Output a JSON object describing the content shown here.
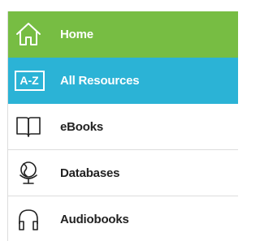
{
  "menu": {
    "items": [
      {
        "label": "Home",
        "icon": "home-icon",
        "state": "home"
      },
      {
        "label": "All Resources",
        "icon": "az-icon",
        "icon_text": "A-Z",
        "state": "active"
      },
      {
        "label": "eBooks",
        "icon": "book-icon",
        "state": "plain"
      },
      {
        "label": "Databases",
        "icon": "globe-icon",
        "state": "plain"
      },
      {
        "label": "Audiobooks",
        "icon": "headphones-icon",
        "state": "plain"
      }
    ]
  },
  "colors": {
    "home_bg": "#77bd43",
    "active_bg": "#2bb3d6",
    "text": "#222222",
    "divider": "#dddddd"
  }
}
